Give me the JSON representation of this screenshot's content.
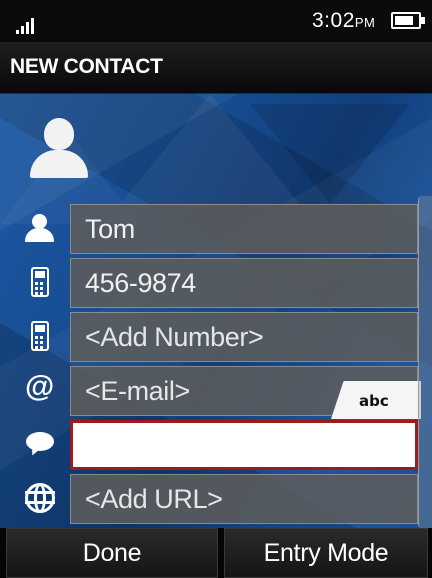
{
  "status_bar": {
    "signal_icon": "signal-bars-icon",
    "time": "3:02",
    "ampm": "PM",
    "battery_icon": "battery-icon",
    "battery_level": 0.8
  },
  "header": {
    "title": "NEW CONTACT"
  },
  "contact": {
    "avatar_icon": "contact-avatar-icon"
  },
  "fields": [
    {
      "icon": "person-icon",
      "value": "Tom",
      "placeholder": false
    },
    {
      "icon": "mobile-phone-icon",
      "value": "456-9874",
      "placeholder": false
    },
    {
      "icon": "mobile-phone-icon",
      "value": "<Add Number>",
      "placeholder": true
    },
    {
      "icon": "email-at-icon",
      "value": "<E-mail>",
      "placeholder": true
    },
    {
      "icon": "chat-bubble-icon",
      "value": "",
      "placeholder": false
    },
    {
      "icon": "globe-icon",
      "value": "<Add URL>",
      "placeholder": true
    }
  ],
  "keyboard_tab": {
    "label": "abc"
  },
  "softkeys": {
    "left": "Done",
    "right": "Entry Mode"
  },
  "colors": {
    "background_blue": "#164b8f",
    "active_border": "#9b1c1c",
    "field_gray": "#5c5c5c"
  }
}
